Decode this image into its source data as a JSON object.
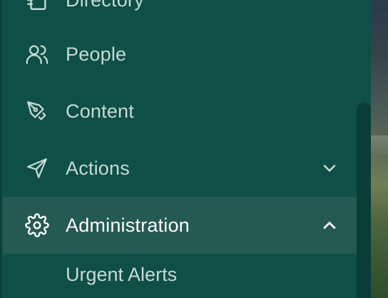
{
  "sidebar": {
    "items": [
      {
        "label": "Directory",
        "icon": "directory-icon"
      },
      {
        "label": "People",
        "icon": "people-icon"
      },
      {
        "label": "Content",
        "icon": "pen-nib-icon"
      },
      {
        "label": "Actions",
        "icon": "send-icon",
        "expanded": false
      },
      {
        "label": "Administration",
        "icon": "gear-icon",
        "expanded": true,
        "active": true
      }
    ],
    "subitems": [
      {
        "label": "Urgent Alerts"
      }
    ]
  },
  "colors": {
    "sidebar_bg": "#0e4f48",
    "active_bg": "#245a53",
    "text": "#c8d9d4",
    "active_text": "#ffffff"
  }
}
